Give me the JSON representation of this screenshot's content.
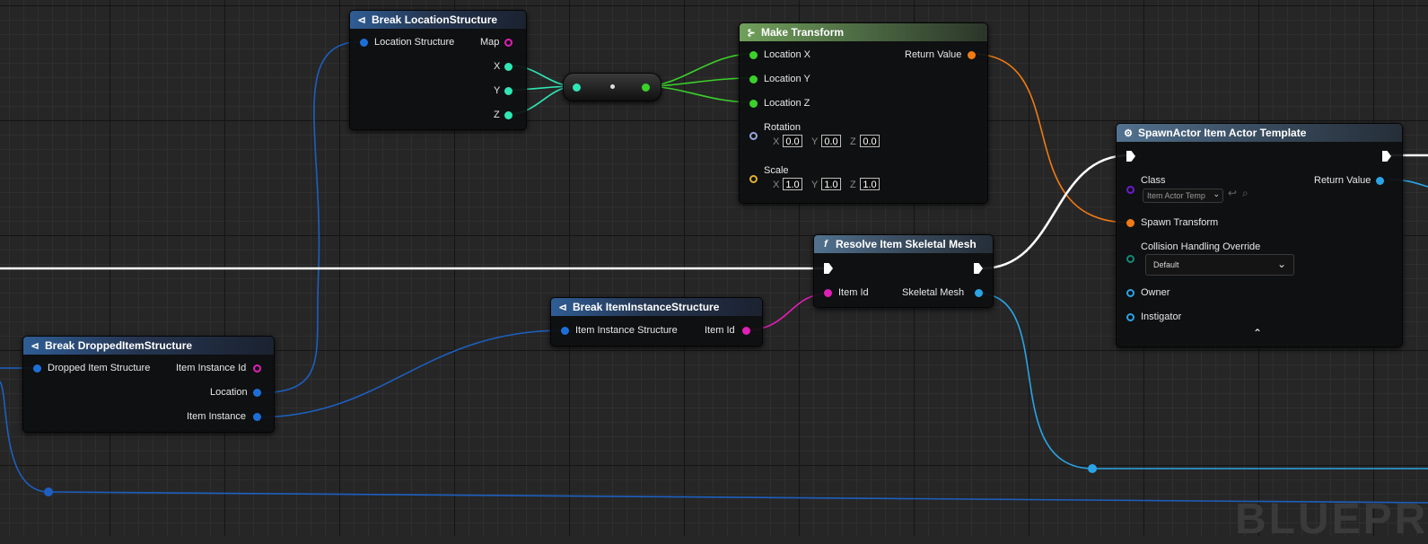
{
  "nodes": {
    "break_location": {
      "title": "Break LocationStructure",
      "input_label": "Location Structure",
      "out_map": "Map",
      "out_x": "X",
      "out_y": "Y",
      "out_z": "Z"
    },
    "make_transform": {
      "title": "Make Transform",
      "location_x": "Location X",
      "location_y": "Location Y",
      "location_z": "Location Z",
      "return_value": "Return Value",
      "rotation": "Rotation",
      "scale": "Scale",
      "axis_x": "X",
      "axis_y": "Y",
      "axis_z": "Z",
      "rotation_values": [
        "0.0",
        "0.0",
        "0.0"
      ],
      "scale_values": [
        "1.0",
        "1.0",
        "1.0"
      ]
    },
    "spawn_actor": {
      "title": "SpawnActor Item Actor Template",
      "class_label": "Class",
      "class_value": "Item Actor Temp",
      "return_value": "Return Value",
      "spawn_transform": "Spawn Transform",
      "collision_label": "Collision Handling Override",
      "collision_value": "Default",
      "owner": "Owner",
      "instigator": "Instigator"
    },
    "resolve_mesh": {
      "title": "Resolve Item Skeletal Mesh",
      "item_id": "Item Id",
      "skeletal_mesh": "Skeletal Mesh"
    },
    "break_item_instance": {
      "title": "Break ItemInstanceStructure",
      "input_label": "Item Instance Structure",
      "item_id": "Item Id"
    },
    "break_dropped_item": {
      "title": "Break DroppedItemStructure",
      "input_label": "Dropped Item Structure",
      "item_instance_id": "Item Instance Id",
      "location": "Location",
      "item_instance": "Item Instance"
    }
  },
  "icons": {
    "break": "break-struct-icon",
    "make": "make-struct-icon",
    "function": "function-icon",
    "spawn": "spawn-actor-icon",
    "browse": "browse-icon",
    "search": "search-icon",
    "chevron_down": "chevron-down-icon",
    "collapse": "chevron-up-icon"
  },
  "colors": {
    "struct_pin": "#1d6fd8",
    "vector_pin": "#2fe6b4",
    "float_pin": "#3ad12b",
    "transform_pin": "#f07a14",
    "name_pin": "#e01fb6",
    "object_pin": "#2aa4e6",
    "class_pin": "#6a1bd0",
    "rotator_pin": "#9aa7e0",
    "scale_pin": "#e0b030",
    "enum_pin": "#0f8a7a"
  },
  "watermark": "BLUEPR"
}
